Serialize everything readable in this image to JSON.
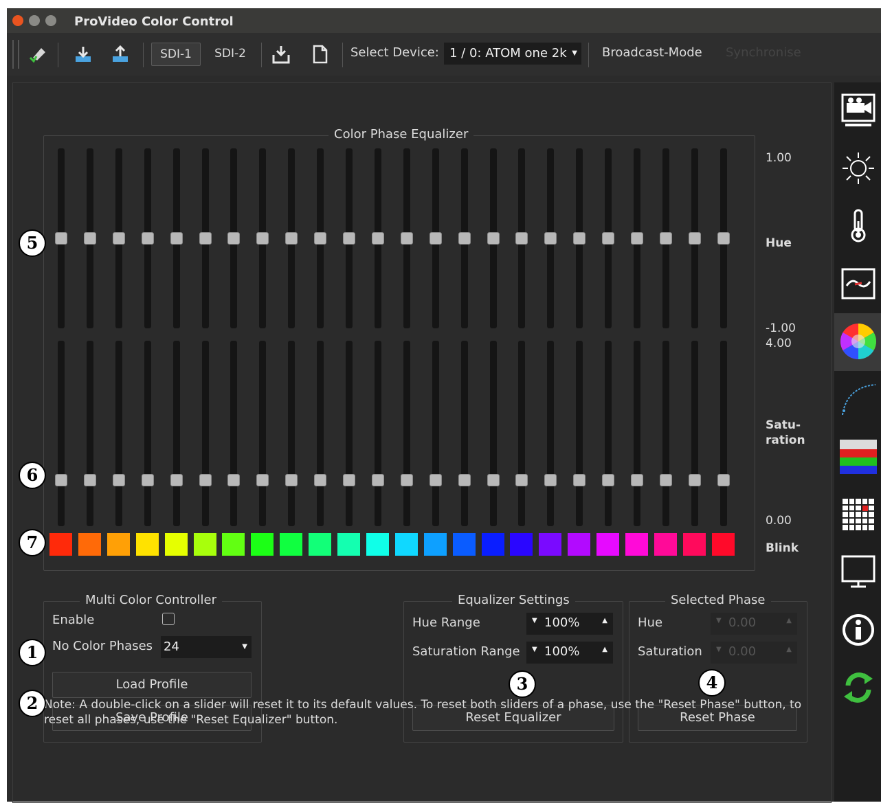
{
  "window": {
    "title": "ProVideo Color Control"
  },
  "toolbar": {
    "tabs": [
      "SDI-1",
      "SDI-2"
    ],
    "select_device_label": "Select Device:",
    "device_value": "1 / 0: ATOM one 2k",
    "broadcast_mode": "Broadcast-Mode",
    "synchronise": "Synchronise"
  },
  "equalizer": {
    "title": "Color Phase Equalizer",
    "hue_scale": {
      "max": "1.00",
      "label": "Hue",
      "min": "-1.00"
    },
    "sat_scale": {
      "max": "4.00",
      "label": "Satu-\nration",
      "min": "0.00"
    },
    "blink_label": "Blink",
    "hue_values": [
      0,
      0,
      0,
      0,
      0,
      0,
      0,
      0,
      0,
      0,
      0,
      0,
      0,
      0,
      0,
      0,
      0,
      0,
      0,
      0,
      0,
      0,
      0,
      0
    ],
    "saturation_values": [
      1,
      1,
      1,
      1,
      1,
      1,
      1,
      1,
      1,
      1,
      1,
      1,
      1,
      1,
      1,
      1,
      1,
      1,
      1,
      1,
      1,
      1,
      1,
      1
    ],
    "phase_colors": [
      "#ff2a0a",
      "#ff6a08",
      "#ffa006",
      "#ffe200",
      "#e6ff00",
      "#a8ff0c",
      "#62ff12",
      "#1cff16",
      "#10ff40",
      "#12ff78",
      "#14ffb0",
      "#10ffe8",
      "#10d8ff",
      "#0ea0ff",
      "#0a5cff",
      "#0a1eff",
      "#2a06ff",
      "#7a0aff",
      "#b20aff",
      "#e60aff",
      "#ff0ad8",
      "#ff0a98",
      "#ff0a5c",
      "#ff0a2a"
    ]
  },
  "multi_color": {
    "title": "Multi Color Controller",
    "enable_label": "Enable",
    "enable_checked": false,
    "phases_label": "No Color Phases",
    "phases_value": "24",
    "load_profile": "Load Profile",
    "save_profile": "Save Profile"
  },
  "eq_settings": {
    "title": "Equalizer Settings",
    "hue_range_label": "Hue Range",
    "hue_range_value": "100%",
    "sat_range_label": "Saturation Range",
    "sat_range_value": "100%",
    "reset_equalizer": "Reset Equalizer"
  },
  "selected_phase": {
    "title": "Selected Phase",
    "hue_label": "Hue",
    "hue_value": "0.00",
    "sat_label": "Saturation",
    "sat_value": "0.00",
    "reset_phase": "Reset Phase"
  },
  "note": "Note: A double-click on a slider will reset it to its default values. To reset both sliders of a phase, use the \"Reset Phase\" button, to reset all phases, use the \"Reset Equalizer\" button.",
  "callouts": [
    "1",
    "2",
    "3",
    "4",
    "5",
    "6",
    "7"
  ],
  "sidebar": {
    "items": [
      "camera-icon",
      "sun-icon",
      "thermometer-icon",
      "waveform-icon",
      "color-wheel-icon",
      "curve-icon",
      "rgb-bars-icon",
      "grid-icon",
      "monitor-icon",
      "info-icon",
      "sync-icon"
    ],
    "active_index": 4
  }
}
